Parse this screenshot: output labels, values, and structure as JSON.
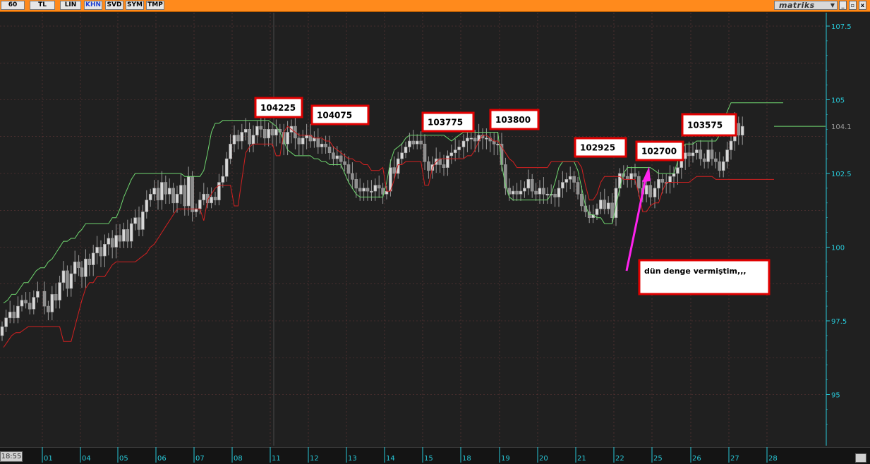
{
  "toolbar": {
    "buttons": [
      {
        "label": "60",
        "active": false
      },
      {
        "label": "TL",
        "active": false
      },
      {
        "label": "LIN",
        "active": false
      },
      {
        "label": "KHN",
        "active": true
      },
      {
        "label": "SVD",
        "active": false
      },
      {
        "label": "SYM",
        "active": false
      },
      {
        "label": "TMP",
        "active": false
      }
    ],
    "brand": "matriks",
    "window_buttons": [
      "_",
      "▫",
      "x"
    ]
  },
  "time_label": "18:55",
  "colors": {
    "background": "#202020",
    "toolbar": "#ff8a1c",
    "upper_band": "#6fd66f",
    "lower_band": "#d42020",
    "candle": "#8f8f8f",
    "axis_text": "#28c8d8",
    "annotation_border": "#e00000",
    "arrow": "#ff22ee"
  },
  "chart_data": {
    "type": "candlestick",
    "yaxis": {
      "ticks": [
        95,
        97.5,
        100,
        102.5,
        105,
        107.5
      ],
      "tick_labels": [
        "95",
        "97.5",
        "100",
        "102.5",
        "105",
        "107.5"
      ],
      "ylim": [
        93.8,
        108.0
      ],
      "last_value_label": "104.1",
      "last_value": 104.1
    },
    "xaxis": {
      "tick_labels": [
        "01",
        "04",
        "05",
        "06",
        "07",
        "08",
        "11",
        "12",
        "13",
        "14",
        "15",
        "18",
        "19",
        "20",
        "21",
        "22",
        "25",
        "26",
        "27",
        "28"
      ]
    },
    "grid": true,
    "upper_band": [
      {
        "day": "01",
        "values": [
          98.1,
          98.2,
          98.4,
          98.4,
          98.6,
          98.8,
          98.8,
          99.0,
          99.2,
          99.3
        ]
      },
      {
        "day": "04",
        "values": [
          99.3,
          99.5,
          99.6,
          99.8,
          100.0,
          100.2,
          100.2,
          100.3,
          100.3,
          100.5
        ]
      },
      {
        "day": "05",
        "values": [
          100.6,
          100.8,
          100.8,
          100.8,
          100.8,
          100.8,
          100.8,
          100.8,
          101.0,
          101.0
        ]
      },
      {
        "day": "06",
        "values": [
          101.3,
          101.7,
          102.0,
          102.3,
          102.5,
          102.5,
          102.5,
          102.5,
          102.5,
          102.5
        ]
      },
      {
        "day": "07",
        "values": [
          102.5,
          102.5,
          102.5,
          102.5,
          102.5,
          102.5,
          102.5,
          102.4,
          102.4,
          102.4
        ]
      },
      {
        "day": "08",
        "values": [
          102.4,
          102.4,
          102.6,
          103.2,
          103.9,
          104.2,
          104.2,
          104.3,
          104.3,
          104.3
        ]
      },
      {
        "day": "11",
        "values": [
          104.3,
          104.3,
          104.3,
          104.3,
          104.3,
          104.3,
          104.3,
          104.3,
          104.3,
          104.3
        ]
      },
      {
        "day": "12",
        "values": [
          104.2,
          104.1,
          103.9,
          103.6,
          103.3,
          103.2,
          103.1,
          103.1,
          103.1,
          103.1
        ]
      },
      {
        "day": "13",
        "values": [
          103.1,
          103.0,
          103.0,
          102.9,
          102.9,
          102.8,
          102.8,
          102.8,
          102.8,
          102.5
        ]
      },
      {
        "day": "14",
        "values": [
          102.2,
          102.0,
          101.8,
          101.7,
          101.7,
          101.7,
          101.7,
          101.7,
          101.7,
          101.7
        ]
      },
      {
        "day": "15",
        "values": [
          102.2,
          102.9,
          103.3,
          103.4,
          103.5,
          103.7,
          103.8,
          103.8,
          103.8,
          103.8
        ]
      },
      {
        "day": "18",
        "values": [
          103.8,
          103.8,
          103.8,
          103.8,
          103.8,
          103.8,
          103.7,
          103.6,
          103.7,
          103.8
        ]
      },
      {
        "day": "19",
        "values": [
          103.9,
          103.9,
          103.9,
          103.9,
          103.9,
          103.9,
          103.9,
          103.9,
          103.9,
          103.9
        ]
      },
      {
        "day": "20",
        "values": [
          102.8,
          102.1,
          101.7,
          101.6,
          101.6,
          101.6,
          101.6,
          101.6,
          101.6,
          101.6
        ]
      },
      {
        "day": "21",
        "values": [
          101.6,
          101.6,
          101.6,
          101.8,
          102.2,
          102.7,
          102.9,
          102.9,
          102.9,
          102.9
        ]
      },
      {
        "day": "22",
        "values": [
          102.6,
          102.0,
          101.4,
          101.1,
          101.1,
          101.0,
          101.0,
          100.8,
          100.8,
          100.8
        ]
      },
      {
        "day": "25",
        "values": [
          101.4,
          102.0,
          102.5,
          102.7,
          102.7,
          102.7,
          102.7,
          102.7,
          102.7,
          102.7
        ]
      },
      {
        "day": "26",
        "values": [
          102.6,
          102.5,
          102.5,
          102.5,
          102.5,
          102.5,
          102.9,
          103.3,
          103.5,
          103.5
        ]
      },
      {
        "day": "27",
        "values": [
          103.5,
          103.6,
          103.6,
          103.6,
          103.6,
          103.6,
          103.6,
          103.8,
          104.2,
          104.6
        ]
      },
      {
        "day": "28",
        "values": [
          104.9,
          104.9,
          104.9,
          104.9
        ]
      }
    ],
    "lower_band": [
      {
        "day": "01",
        "values": [
          96.6,
          96.8,
          97.0,
          97.1,
          97.1,
          97.2,
          97.3,
          97.3,
          97.3,
          97.3
        ]
      },
      {
        "day": "04",
        "values": [
          97.3,
          97.3,
          97.3,
          97.3,
          97.3,
          96.8,
          96.8,
          96.8,
          97.3,
          97.8
        ]
      },
      {
        "day": "05",
        "values": [
          98.2,
          98.6,
          98.8,
          98.8,
          99.0,
          99.0,
          99.0,
          99.2,
          99.4,
          99.5
        ]
      },
      {
        "day": "06",
        "values": [
          99.5,
          99.5,
          99.5,
          99.5,
          99.5,
          99.6,
          99.7,
          99.8,
          100.0,
          100.1
        ]
      },
      {
        "day": "07",
        "values": [
          100.3,
          100.5,
          100.7,
          100.9,
          101.1,
          101.3,
          101.3,
          101.3,
          101.3,
          101.3
        ]
      },
      {
        "day": "08",
        "values": [
          101.3,
          101.3,
          100.9,
          101.6,
          101.8,
          102.0,
          102.1,
          102.1,
          102.1,
          102.1
        ]
      },
      {
        "day": "11",
        "values": [
          101.4,
          101.4,
          102.3,
          103.2,
          103.4,
          103.5,
          103.5,
          103.5,
          103.5,
          103.5
        ]
      },
      {
        "day": "12",
        "values": [
          103.5,
          103.1,
          103.1,
          103.9,
          104.1,
          104.0,
          103.9,
          103.8,
          103.8,
          103.8
        ]
      },
      {
        "day": "13",
        "values": [
          103.8,
          103.7,
          103.7,
          103.7,
          103.6,
          103.6,
          103.4,
          103.3,
          103.2,
          103.1
        ]
      },
      {
        "day": "14",
        "values": [
          103.0,
          103.0,
          102.9,
          102.9,
          102.8,
          102.8,
          102.6,
          102.6,
          102.6,
          102.7
        ]
      },
      {
        "day": "15",
        "values": [
          101.9,
          101.9,
          102.3,
          102.8,
          102.8,
          102.9,
          102.9,
          102.9,
          102.9,
          102.9
        ]
      },
      {
        "day": "18",
        "values": [
          102.1,
          102.1,
          102.7,
          102.9,
          103.0,
          103.0,
          103.0,
          103.0,
          103.0,
          103.0
        ]
      },
      {
        "day": "19",
        "values": [
          103.0,
          103.1,
          103.1,
          103.3,
          103.6,
          103.8,
          103.8,
          103.7,
          103.6,
          103.6
        ]
      },
      {
        "day": "20",
        "values": [
          103.4,
          103.2,
          103.0,
          102.9,
          102.7,
          102.7,
          102.7,
          102.7,
          102.7,
          102.7
        ]
      },
      {
        "day": "21",
        "values": [
          102.7,
          102.7,
          102.7,
          102.9,
          102.9,
          102.9,
          102.9,
          102.9,
          102.9,
          102.9
        ]
      },
      {
        "day": "22",
        "values": [
          102.9,
          102.7,
          102.1,
          101.6,
          101.6,
          101.8,
          102.2,
          102.4,
          102.4,
          102.4
        ]
      },
      {
        "day": "25",
        "values": [
          102.4,
          102.4,
          102.3,
          102.3,
          102.3,
          102.3,
          101.8,
          101.2,
          101.2,
          101.4
        ]
      },
      {
        "day": "26",
        "values": [
          101.5,
          101.5,
          101.9,
          102.2,
          102.2,
          102.2,
          102.2,
          102.2,
          102.2,
          102.2
        ]
      },
      {
        "day": "27",
        "values": [
          102.3,
          102.4,
          102.4,
          102.4,
          102.4,
          102.4,
          102.3,
          102.3,
          102.3,
          102.3
        ]
      },
      {
        "day": "28",
        "values": [
          102.3,
          102.3,
          102.3,
          102.3
        ]
      }
    ],
    "candles_close": [
      {
        "day": "01",
        "values": [
          97.3,
          97.6,
          97.8,
          97.6,
          98.0,
          98.2,
          98.1,
          97.9,
          98.3,
          98.5
        ]
      },
      {
        "day": "04",
        "values": [
          98.0,
          97.8,
          98.4,
          98.2,
          98.8,
          99.2,
          98.6,
          99.1,
          99.5,
          99.3
        ]
      },
      {
        "day": "05",
        "values": [
          99.0,
          99.6,
          99.4,
          99.8,
          100.0,
          99.7,
          100.1,
          100.3,
          100.0,
          100.4
        ]
      },
      {
        "day": "06",
        "values": [
          100.2,
          100.6,
          100.2,
          100.8,
          101.0,
          100.6,
          101.2,
          101.6,
          101.8,
          102.0
        ]
      },
      {
        "day": "07",
        "values": [
          101.6,
          102.2,
          101.8,
          102.0,
          101.5,
          101.8,
          102.1,
          101.4,
          102.4,
          101.2
        ]
      },
      {
        "day": "08",
        "values": [
          101.3,
          101.6,
          101.8,
          101.5,
          101.7,
          101.6,
          102.2,
          102.4,
          103.0,
          103.5
        ]
      },
      {
        "day": "11",
        "values": [
          103.8,
          103.6,
          103.9,
          104.0,
          103.5,
          103.8,
          104.1,
          104.0,
          103.7,
          104.0
        ]
      },
      {
        "day": "12",
        "values": [
          103.8,
          104.0,
          103.9,
          103.5,
          103.9,
          104.1,
          103.7,
          103.5,
          103.7,
          103.8
        ]
      },
      {
        "day": "13",
        "values": [
          103.6,
          103.7,
          103.4,
          103.5,
          103.4,
          103.2,
          103.0,
          103.1,
          102.9,
          102.8
        ]
      },
      {
        "day": "14",
        "values": [
          102.5,
          102.3,
          102.0,
          101.9,
          102.0,
          101.9,
          101.9,
          102.1,
          102.0,
          101.8
        ]
      },
      {
        "day": "15",
        "values": [
          101.9,
          102.7,
          102.5,
          103.0,
          103.2,
          103.4,
          103.6,
          103.5,
          103.6,
          103.5
        ]
      },
      {
        "day": "18",
        "values": [
          102.9,
          102.6,
          102.8,
          103.0,
          102.8,
          102.7,
          103.1,
          103.2,
          103.3,
          103.4
        ]
      },
      {
        "day": "19",
        "values": [
          103.6,
          103.7,
          103.7,
          103.6,
          103.8,
          103.7,
          103.7,
          103.6,
          103.5,
          103.5
        ]
      },
      {
        "day": "20",
        "values": [
          102.8,
          102.0,
          101.8,
          101.9,
          101.8,
          101.9,
          102.0,
          102.3,
          101.9,
          101.8
        ]
      },
      {
        "day": "21",
        "values": [
          102.0,
          101.8,
          101.8,
          101.8,
          101.7,
          102.0,
          102.2,
          102.3,
          102.4,
          102.2
        ]
      },
      {
        "day": "22",
        "values": [
          101.8,
          101.4,
          101.2,
          101.0,
          101.1,
          101.3,
          101.6,
          101.3,
          101.5,
          101.0
        ]
      },
      {
        "day": "25",
        "values": [
          102.0,
          102.5,
          102.4,
          102.3,
          102.5,
          102.4,
          102.0,
          101.8,
          102.1,
          101.7
        ]
      },
      {
        "day": "26",
        "values": [
          102.0,
          102.3,
          102.2,
          102.2,
          102.4,
          102.5,
          102.7,
          103.0,
          103.2,
          103.1
        ]
      },
      {
        "day": "27",
        "values": [
          103.2,
          103.3,
          103.0,
          102.9,
          103.3,
          103.0,
          102.9,
          102.6,
          102.9,
          103.3
        ]
      },
      {
        "day": "28",
        "values": [
          103.6,
          104.2,
          103.8,
          104.1
        ]
      }
    ],
    "annotations": [
      {
        "text": "104225",
        "value": 104225,
        "day": "11"
      },
      {
        "text": "104075",
        "value": 104075,
        "day": "12"
      },
      {
        "text": "103775",
        "value": 103775,
        "day": "15"
      },
      {
        "text": "103800",
        "value": 103800,
        "day": "19"
      },
      {
        "text": "102925",
        "value": 102925,
        "day": "21"
      },
      {
        "text": "102700",
        "value": 102700,
        "day": "25"
      },
      {
        "text": "103575",
        "value": 103575,
        "day": "26"
      }
    ],
    "note": {
      "text": "dün denge vermiştim,,,",
      "day": "25",
      "arrow_color": "#ff22ee"
    }
  }
}
